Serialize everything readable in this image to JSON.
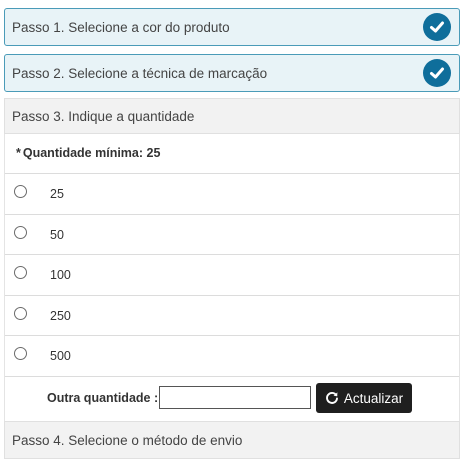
{
  "steps": {
    "step1": {
      "label": "Passo 1. Selecione a cor do produto"
    },
    "step2": {
      "label": "Passo 2. Selecione a técnica de marcação"
    },
    "step3": {
      "label": "Passo 3. Indique a quantidade"
    },
    "step4": {
      "label": "Passo 4. Selecione o método de envio"
    }
  },
  "quantity": {
    "min_star": "*",
    "min_label": "Quantidade mínima: 25",
    "options": [
      "25",
      "50",
      "100",
      "250",
      "500"
    ],
    "selected": null,
    "other_label": "Outra quantidade :",
    "other_value": "",
    "update_label": "Actualizar"
  },
  "icons": {
    "done": "check-circle-icon",
    "refresh": "refresh-icon"
  },
  "colors": {
    "done_accent": "#0f6e9b",
    "done_border": "#4a9bb8",
    "button_bg": "#1f1f1f"
  }
}
